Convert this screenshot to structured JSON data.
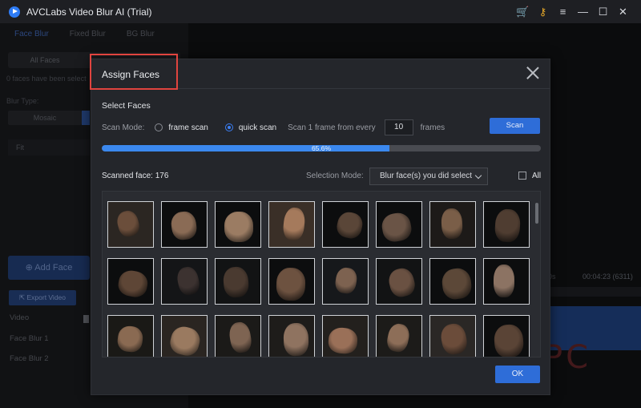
{
  "window": {
    "title": "AVCLabs Video Blur AI (Trial)",
    "icons": [
      "cart-icon",
      "key-icon",
      "menu-icon",
      "minimize-icon",
      "maximize-icon",
      "close-icon"
    ]
  },
  "background": {
    "tabs": [
      "Face Blur",
      "Fixed Blur",
      "BG Blur"
    ],
    "segment_all": "All Faces",
    "note": "0 faces have been select",
    "blur_type_label": "Blur Type:",
    "mosaic_label": "Mosaic",
    "fit_label": "Fit",
    "add_face_label": "Add Face",
    "export_label": "Export Video",
    "tracks": [
      "Video",
      "Face Blur 1",
      "Face Blur 2"
    ],
    "time": "00:04:23 (6311)",
    "time_prefix": "0s"
  },
  "dialog": {
    "title": "Assign Faces",
    "section_label": "Select Faces",
    "scan_mode_label": "Scan Mode:",
    "option_frame": "frame scan",
    "option_quick": "quick scan",
    "selected_option": "quick scan",
    "scan_every_label": "Scan 1 frame from every",
    "frames_value": "10",
    "frames_unit": "frames",
    "scan_button": "Scan",
    "progress_text": "65.6%",
    "progress_value": 0.656,
    "scanned_label": "Scanned face: 176",
    "selection_mode_label": "Selection Mode:",
    "selection_mode_value": "Blur face(s) you did select",
    "all_label": "All",
    "all_checked": false,
    "ok_button": "OK"
  },
  "colors": {
    "accent": "#2e6dd8",
    "progress": "#3b88ee",
    "highlight": "#e0443f"
  },
  "faces": [
    {
      "tone": "#6b4e3b",
      "bg": "#2b2622"
    },
    {
      "tone": "#8a6b55",
      "bg": "#0c0d0e"
    },
    {
      "tone": "#9b7c63",
      "bg": "#0c0d0e"
    },
    {
      "tone": "#a57a5c",
      "bg": "#3a2f27"
    },
    {
      "tone": "#5a4638",
      "bg": "#0c0d0e"
    },
    {
      "tone": "#6a5446",
      "bg": "#0c0d0e"
    },
    {
      "tone": "#7a5e48",
      "bg": "#1d1a18"
    },
    {
      "tone": "#4f3d31",
      "bg": "#0c0d0e"
    },
    {
      "tone": "#5e4636",
      "bg": "#0c0d0e"
    },
    {
      "tone": "#3c3230",
      "bg": "#141517"
    },
    {
      "tone": "#4a3a30",
      "bg": "#121314"
    },
    {
      "tone": "#6d5240",
      "bg": "#0c0d0e"
    },
    {
      "tone": "#7d6250",
      "bg": "#16181b"
    },
    {
      "tone": "#6a5142",
      "bg": "#121314"
    },
    {
      "tone": "#5c4838",
      "bg": "#0c0d0e"
    },
    {
      "tone": "#8c7363",
      "bg": "#0c0d0e"
    },
    {
      "tone": "#8a6a52",
      "bg": "#1a1916"
    },
    {
      "tone": "#9a7a60",
      "bg": "#2a2521"
    },
    {
      "tone": "#7e6452",
      "bg": "#1b1a18"
    },
    {
      "tone": "#8f7360",
      "bg": "#1e1c1a"
    },
    {
      "tone": "#9a7058",
      "bg": "#23201d"
    },
    {
      "tone": "#8d6e58",
      "bg": "#1c1b19"
    },
    {
      "tone": "#6b4c3a",
      "bg": "#2a2725"
    },
    {
      "tone": "#5a4436",
      "bg": "#0c0d0e"
    }
  ]
}
